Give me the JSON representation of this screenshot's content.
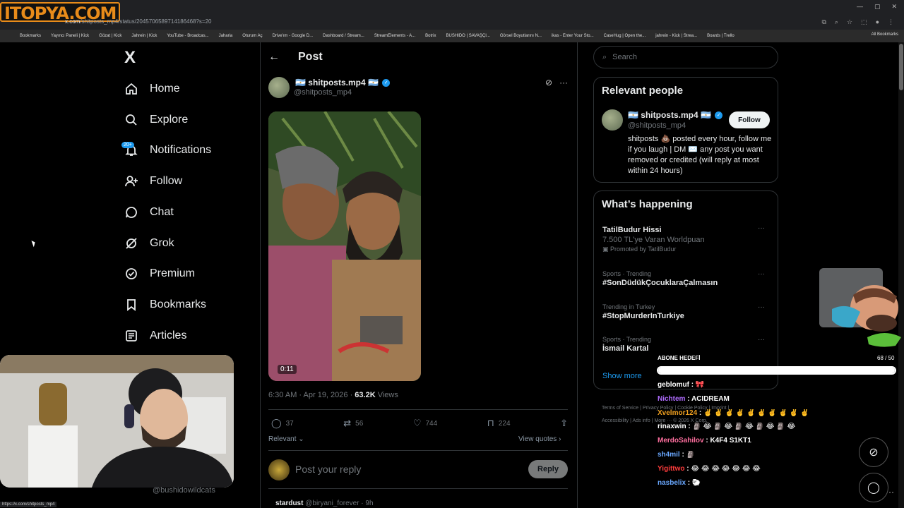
{
  "browser": {
    "watermark": "ITOPYA.COM",
    "address_domain": "x.com",
    "address_path": "/shitposts_mp4/status/2045706589714186468?s=20",
    "bookmarks": [
      "Bookmarks",
      "Yayıncı Paneli | Kick",
      "Gözat | Kick",
      "Jahrein | Kick",
      "YouTube - Broadcas...",
      "Jaharia",
      "Oturum Aç",
      "Drive'ım - Google D...",
      "Dashboard / Stream...",
      "StreamElements - A...",
      "Botrix",
      "BUSHIDO | SAVAŞÇI...",
      "Görsel Boyutlarını N...",
      "ikas - Enter Your Sto...",
      "CaseHug | Open the...",
      "jahrein - Kick | Strea...",
      "Boards | Trello"
    ],
    "all_bookmarks": "All Bookmarks",
    "status_url": "https://x.com/shitposts_mp4"
  },
  "nav": {
    "logo": "X",
    "items": [
      {
        "label": "Home",
        "icon": "home-icon"
      },
      {
        "label": "Explore",
        "icon": "search-icon"
      },
      {
        "label": "Notifications",
        "icon": "bell-icon"
      },
      {
        "label": "Follow",
        "icon": "person-plus-icon"
      },
      {
        "label": "Chat",
        "icon": "chat-bubble-icon"
      },
      {
        "label": "Grok",
        "icon": "grok-icon"
      },
      {
        "label": "Premium",
        "icon": "verified-badge-icon"
      },
      {
        "label": "Bookmarks",
        "icon": "bookmark-icon"
      },
      {
        "label": "Articles",
        "icon": "article-icon"
      }
    ],
    "notification_badge": "20+",
    "account_handle": "@bushidowildcats"
  },
  "post": {
    "header_title": "Post",
    "author_name": "🇦🇷 shitposts.mp4 🇦🇷",
    "author_handle": "@shitposts_mp4",
    "video_duration": "0:11",
    "time": "6:30 AM · Apr 19, 2026 · ",
    "views": "63.2K",
    "views_label": " Views",
    "replies": "37",
    "reposts": "56",
    "likes": "744",
    "bookmarks": "224",
    "sort_label": "Relevant ⌄",
    "view_quotes": "View quotes ›",
    "reply_placeholder": "Post your reply",
    "reply_button": "Reply",
    "next_author": "stardust",
    "next_meta": "@biryani_forever · 9h"
  },
  "sidebar": {
    "search_placeholder": "Search",
    "relevant_title": "Relevant people",
    "relevant_name": "🇦🇷 shitposts.mp4 🇦🇷",
    "relevant_handle": "@shitposts_mp4",
    "follow_label": "Follow",
    "relevant_bio": "shitposts 💩 posted every hour, follow me if you laugh | DM ✉️ any post you want removed or credited (will reply at most within 24 hours)",
    "happening_title": "What’s happening",
    "trends": [
      {
        "category": "",
        "name": "TatilBudur Hissi",
        "sub": "7.500 TL'ye Varan Worldpuan",
        "promo": "Promoted by TatilBudur"
      },
      {
        "category": "Sports · Trending",
        "name": "#SonDüdükÇocuklaraÇalmasın",
        "sub": "",
        "promo": ""
      },
      {
        "category": "Trending in Turkey",
        "name": "#StopMurderInTurkiye",
        "sub": "",
        "promo": ""
      },
      {
        "category": "Sports · Trending",
        "name": "İsmail Kartal",
        "sub": "",
        "promo": ""
      }
    ],
    "show_more": "Show more",
    "footer": "Terms of Service | Privacy Policy | Cookie Policy | Imprint | Accessibility | Ads info | More ··· © 2026 X Corp."
  },
  "overlay": {
    "sub_goal_label": "ABONE HEDEFİ",
    "sub_goal_count": "68 / 50",
    "sub_goal_progress": 1.0,
    "chat": [
      {
        "user": "geblomuf",
        "color": "#ffffff",
        "msg": "🎀"
      },
      {
        "user": "Nichtem",
        "color": "#b06cff",
        "msg": "ACIDREAM"
      },
      {
        "user": "Xvelmor124",
        "color": "#f0a020",
        "msg": "✌️ ✌️ ✌️ ✌️ ✌️ ✌️ ✌️ ✌️ ✌️ ✌️"
      },
      {
        "user": "rinaxwin",
        "color": "#ffffff",
        "msg": "🗿 😂 🗿 😂 🗿 😂 🗿 😂 🗿 😂"
      },
      {
        "user": "MerdoSahilov",
        "color": "#ff6f9f",
        "msg": "K4F4 S1KT1"
      },
      {
        "user": "sh4mil",
        "color": "#6aa8ff",
        "msg": "🗿"
      },
      {
        "user": "Yigittwo",
        "color": "#ff3c3c",
        "msg": "😂 😂 😂 😂 😂 😂 😂"
      },
      {
        "user": "nasbelix",
        "color": "#6aa8ff",
        "msg": "🐑"
      }
    ]
  },
  "colors": {
    "accent": "#1d9bf0",
    "background": "#000000",
    "muted": "#71767b"
  }
}
